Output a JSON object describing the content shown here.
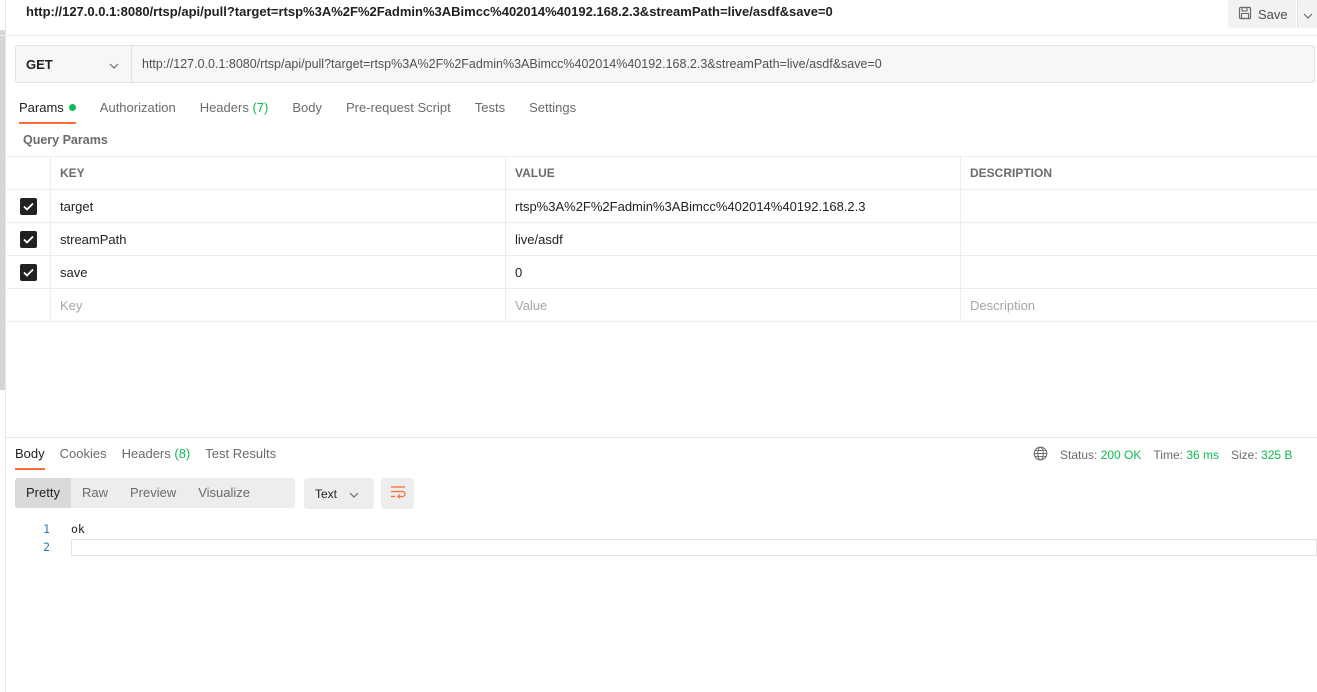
{
  "header": {
    "request_url": "http://127.0.0.1:8080/rtsp/api/pull?target=rtsp%3A%2F%2Fadmin%3ABimcc%402014%40192.168.2.3&streamPath=live/asdf&save=0",
    "save_label": "Save"
  },
  "request": {
    "method": "GET",
    "url": "http://127.0.0.1:8080/rtsp/api/pull?target=rtsp%3A%2F%2Fadmin%3ABimcc%402014%40192.168.2.3&streamPath=live/asdf&save=0",
    "tabs": [
      {
        "label": "Params",
        "active": true,
        "dot": true
      },
      {
        "label": "Authorization"
      },
      {
        "label": "Headers",
        "count": "(7)"
      },
      {
        "label": "Body"
      },
      {
        "label": "Pre-request Script"
      },
      {
        "label": "Tests"
      },
      {
        "label": "Settings"
      }
    ]
  },
  "query_params": {
    "section_label": "Query Params",
    "headers": {
      "key": "KEY",
      "value": "VALUE",
      "description": "DESCRIPTION"
    },
    "rows": [
      {
        "checked": true,
        "key": "target",
        "value": "rtsp%3A%2F%2Fadmin%3ABimcc%402014%40192.168.2.3",
        "description": ""
      },
      {
        "checked": true,
        "key": "streamPath",
        "value": "live/asdf",
        "description": ""
      },
      {
        "checked": true,
        "key": "save",
        "value": "0",
        "description": ""
      }
    ],
    "placeholders": {
      "key": "Key",
      "value": "Value",
      "description": "Description"
    }
  },
  "response": {
    "tabs": [
      {
        "label": "Body",
        "active": true
      },
      {
        "label": "Cookies"
      },
      {
        "label": "Headers",
        "count": "(8)"
      },
      {
        "label": "Test Results"
      }
    ],
    "status": {
      "status_label": "Status:",
      "status_value": "200 OK",
      "time_label": "Time:",
      "time_value": "36 ms",
      "size_label": "Size:",
      "size_value": "325 B"
    },
    "formats": [
      "Pretty",
      "Raw",
      "Preview",
      "Visualize"
    ],
    "active_format": "Pretty",
    "language": "Text",
    "lines": [
      {
        "number": "1",
        "text": "ok"
      },
      {
        "number": "2",
        "text": ""
      }
    ]
  },
  "colors": {
    "accent": "#ff6c37",
    "success": "#0cbb52",
    "line_number": "#2a7ab0"
  },
  "icons": [
    "save-icon",
    "chevron-down-icon",
    "checkbox-checked-icon",
    "globe-icon",
    "wrap-lines-icon"
  ]
}
